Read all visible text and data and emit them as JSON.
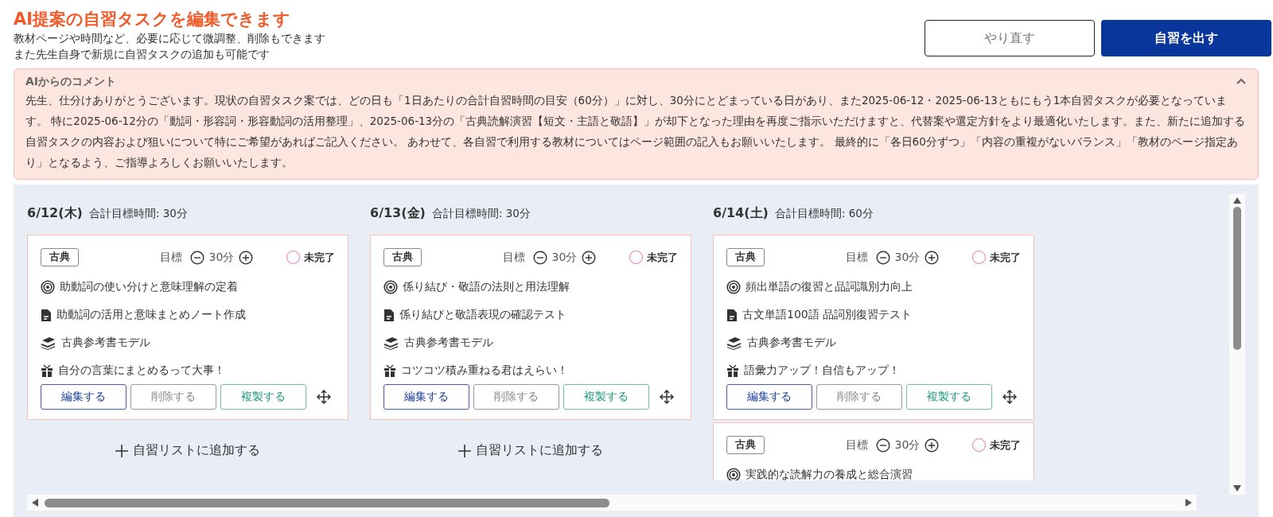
{
  "header": {
    "title": "AI提案の自習タスクを編集できます",
    "subtitle_lines": [
      "教材ページや時間など、必要に応じて微調整、削除もできます",
      "また先生自身で新規に自習タスクの追加も可能です"
    ]
  },
  "buttons": [
    {
      "label": "やり直す",
      "kind": "outline"
    },
    {
      "label": "自習を出す",
      "kind": "primary"
    }
  ],
  "comment": {
    "title": "AIからのコメント",
    "expanded": true,
    "text": "先生、仕分けありがとうございます。現状の自習タスク案では、どの日も「1日あたりの合計自習時間の目安（60分）」に対し、30分にとどまっている日があり、また2025-06-12・2025-06-13ともにもう1本自習タスクが必要となっています。 特に2025-06-12分の「動詞・形容詞・形容動詞の活用整理」、2025-06-13分の「古典読解演習【短文・主語と敬語】」が却下となった理由を再度ご指示いただけますと、代替案や選定方針をより最適化いたします。また、新たに追加する自習タスクの内容および狙いについて特にご希望があればご記入ください。 あわせて、各自習で利用する教材についてはページ範囲の記入もお願いいたします。 最終的に「各日60分ずつ」「内容の重複がないバランス」「教材のページ指定あり」となるよう、ご指導よろしくお願いいたします。"
  },
  "days": [
    {
      "date": "6/12(木)",
      "total": "合計目標時間: 30分",
      "add_label": "自習リストに追加する",
      "tasks": [
        {
          "subject": "古典",
          "target_label": "目標",
          "minutes": "30分",
          "status": "未完了",
          "done": false,
          "goal": "助動詞の使い分けと意味理解の定着",
          "task": "助動詞の活用と意味まとめノート作成",
          "material": "古典参考書モデル",
          "message": "自分の言葉にまとめるって大事！",
          "actions": [
            "編集する",
            "削除する",
            "複製する"
          ]
        }
      ]
    },
    {
      "date": "6/13(金)",
      "total": "合計目標時間: 30分",
      "add_label": "自習リストに追加する",
      "tasks": [
        {
          "subject": "古典",
          "target_label": "目標",
          "minutes": "30分",
          "status": "未完了",
          "done": false,
          "goal": "係り結び・敬語の法則と用法理解",
          "task": "係り結びと敬語表現の確認テスト",
          "material": "古典参考書モデル",
          "message": "コツコツ積み重ねる君はえらい！",
          "actions": [
            "編集する",
            "削除する",
            "複製する"
          ]
        }
      ]
    },
    {
      "date": "6/14(土)",
      "total": "合計目標時間: 60分",
      "tasks": [
        {
          "subject": "古典",
          "target_label": "目標",
          "minutes": "30分",
          "status": "未完了",
          "done": false,
          "goal": "頻出単語の復習と品詞識別力向上",
          "task": "古文単語100語 品詞別復習テスト",
          "material": "古典参考書モデル",
          "message": "語彙力アップ！自信もアップ！",
          "actions": [
            "編集する",
            "削除する",
            "複製する"
          ]
        },
        {
          "subject": "古典",
          "target_label": "目標",
          "minutes": "30分",
          "status": "未完了",
          "done": false,
          "goal": "実践的な読解力の養成と総合演習"
        }
      ]
    }
  ]
}
